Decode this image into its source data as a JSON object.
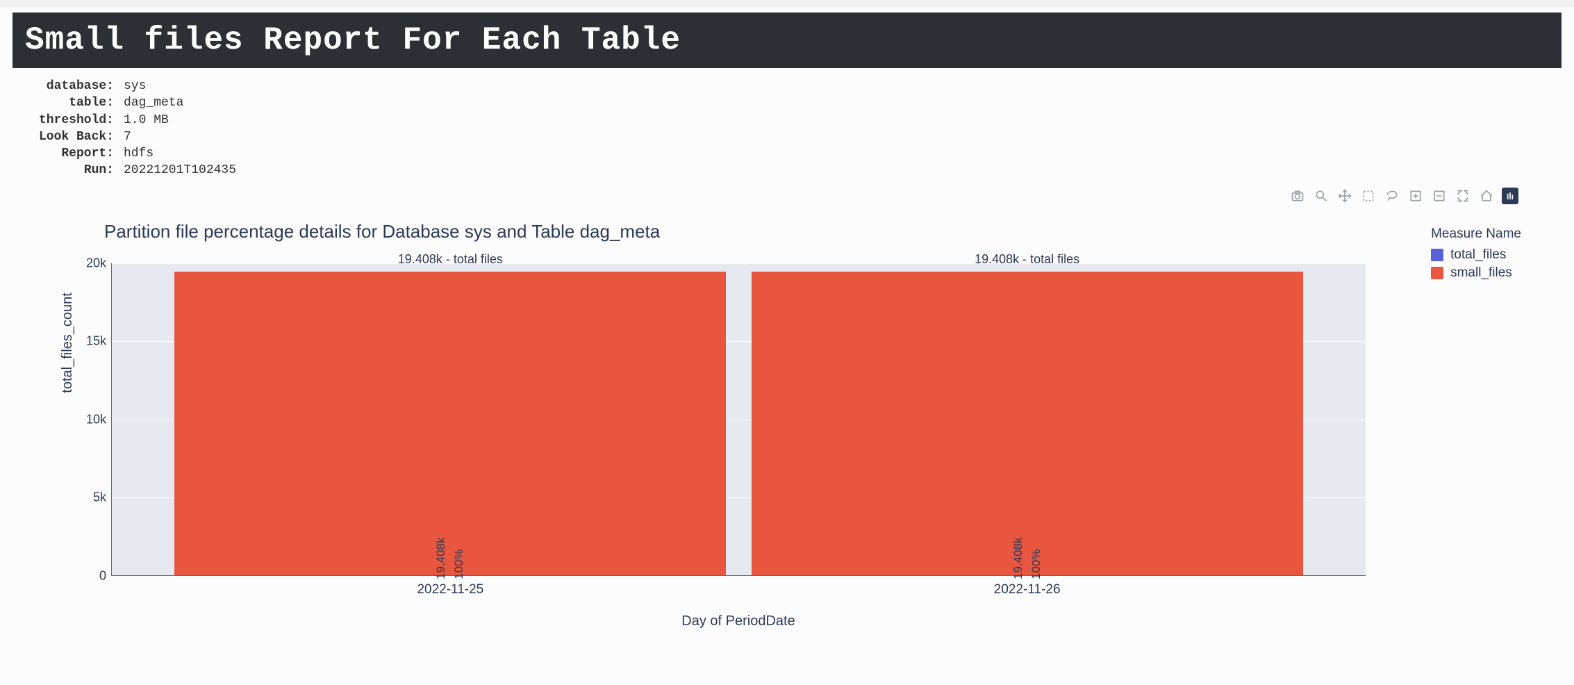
{
  "header": {
    "title": "Small files Report For Each Table"
  },
  "meta": {
    "rows": [
      {
        "key": "database:",
        "value": "sys"
      },
      {
        "key": "table:",
        "value": "dag_meta"
      },
      {
        "key": "threshold:",
        "value": "1.0 MB"
      },
      {
        "key": "Look Back:",
        "value": "7"
      },
      {
        "key": "Report:",
        "value": "hdfs"
      },
      {
        "key": "Run:",
        "value": "20221201T102435"
      }
    ]
  },
  "toolbar": {
    "items": [
      {
        "name": "camera-icon",
        "active": false
      },
      {
        "name": "zoom-icon",
        "active": false
      },
      {
        "name": "pan-icon",
        "active": false
      },
      {
        "name": "box-select-icon",
        "active": false
      },
      {
        "name": "lasso-select-icon",
        "active": false
      },
      {
        "name": "zoom-in-icon",
        "active": false
      },
      {
        "name": "zoom-out-icon",
        "active": false
      },
      {
        "name": "autoscale-icon",
        "active": false
      },
      {
        "name": "reset-axes-icon",
        "active": false
      },
      {
        "name": "plotly-logo-icon",
        "active": true
      }
    ]
  },
  "chart": {
    "title": "Partition file percentage details for Database sys and Table dag_meta",
    "ylabel": "total_files_count",
    "xlabel": "Day of PeriodDate",
    "legend_title": "Measure Name",
    "legend_items": [
      {
        "label": "total_files",
        "class": "total"
      },
      {
        "label": "small_files",
        "class": "small"
      }
    ],
    "yticks": [
      {
        "label": "20k",
        "value": 20000
      },
      {
        "label": "15k",
        "value": 15000
      },
      {
        "label": "10k",
        "value": 10000
      },
      {
        "label": "5k",
        "value": 5000
      },
      {
        "label": "0",
        "value": 0
      }
    ],
    "ymax": 20000,
    "bars": [
      {
        "x": "2022-11-25",
        "top_label": "19.408k - total files",
        "inner_label_value": "19.408k",
        "inner_label_pct": "100%",
        "total_files": 19408,
        "small_files": 19408,
        "left_pct": 5
      },
      {
        "x": "2022-11-26",
        "top_label": "19.408k - total files",
        "inner_label_value": "19.408k",
        "inner_label_pct": "100%",
        "total_files": 19408,
        "small_files": 19408,
        "left_pct": 51
      }
    ]
  },
  "chart_data": {
    "type": "bar",
    "title": "Partition file percentage details for Database sys and Table dag_meta",
    "xlabel": "Day of PeriodDate",
    "ylabel": "total_files_count",
    "ylim": [
      0,
      20000
    ],
    "categories": [
      "2022-11-25",
      "2022-11-26"
    ],
    "series": [
      {
        "name": "total_files",
        "values": [
          19408,
          19408
        ]
      },
      {
        "name": "small_files",
        "values": [
          19408,
          19408
        ]
      }
    ],
    "annotations": [
      {
        "category": "2022-11-25",
        "text": "19.408k - total files",
        "inner": "19.408k 100%"
      },
      {
        "category": "2022-11-26",
        "text": "19.408k - total files",
        "inner": "19.408k 100%"
      }
    ],
    "colors": {
      "total_files": "#5862d6",
      "small_files": "#e8563f"
    },
    "legend_position": "right",
    "grid": true
  }
}
